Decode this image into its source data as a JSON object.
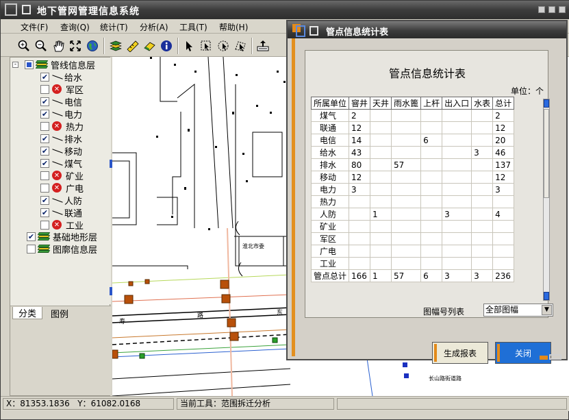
{
  "app": {
    "title": "地下管网管理信息系统"
  },
  "menu": [
    "文件(F)",
    "查询(Q)",
    "统计(T)",
    "分析(A)",
    "工具(T)",
    "帮助(H)"
  ],
  "toolbar": {
    "icons": [
      "zoom-in-icon",
      "zoom-out-icon",
      "pan-hand-icon",
      "full-extent-icon",
      "globe-icon",
      "layers-icon",
      "measure-icon",
      "eraser-icon",
      "info-icon",
      "pointer-icon",
      "select-rect-icon",
      "select-circle-icon",
      "select-poly-icon",
      "export-icon"
    ]
  },
  "tree": {
    "root": {
      "label": "管线信息层",
      "checked": "partial"
    },
    "items": [
      {
        "label": "给水",
        "checked": true
      },
      {
        "label": "军区",
        "checked": false
      },
      {
        "label": "电信",
        "checked": true
      },
      {
        "label": "电力",
        "checked": true
      },
      {
        "label": "热力",
        "checked": false
      },
      {
        "label": "排水",
        "checked": true
      },
      {
        "label": "移动",
        "checked": true
      },
      {
        "label": "煤气",
        "checked": true
      },
      {
        "label": "矿业",
        "checked": false
      },
      {
        "label": "广电",
        "checked": false
      },
      {
        "label": "人防",
        "checked": true
      },
      {
        "label": "联通",
        "checked": true
      },
      {
        "label": "工业",
        "checked": false
      }
    ],
    "layers": [
      {
        "label": "基础地形层",
        "checked": true
      },
      {
        "label": "图廓信息层",
        "checked": false
      }
    ]
  },
  "left_tabs": [
    "分类",
    "图例"
  ],
  "status": {
    "x_label": "X：",
    "x": "81353.1836",
    "y_label": "Y：",
    "y": "61082.0168",
    "tool": "当前工具：范围拆迁分析"
  },
  "map": {
    "labels": [
      "淮北市委",
      "寿",
      "路",
      "东",
      "长山路街道路"
    ]
  },
  "dialog": {
    "title": "管点信息统计表",
    "report_title": "管点信息统计表",
    "unit": "单位：个",
    "columns": [
      "所属单位",
      "窨井",
      "天井",
      "雨水篦",
      "上杆",
      "出入口",
      "水表",
      "总计"
    ],
    "rows": [
      [
        "煤气",
        "2",
        "",
        "",
        "",
        "",
        "",
        "2"
      ],
      [
        "联通",
        "12",
        "",
        "",
        "",
        "",
        "",
        "12"
      ],
      [
        "电信",
        "14",
        "",
        "",
        "6",
        "",
        "",
        "20"
      ],
      [
        "给水",
        "43",
        "",
        "",
        "",
        "",
        "3",
        "46"
      ],
      [
        "排水",
        "80",
        "",
        "57",
        "",
        "",
        "",
        "137"
      ],
      [
        "移动",
        "12",
        "",
        "",
        "",
        "",
        "",
        "12"
      ],
      [
        "电力",
        "3",
        "",
        "",
        "",
        "",
        "",
        "3"
      ],
      [
        "热力",
        "",
        "",
        "",
        "",
        "",
        "",
        ""
      ],
      [
        "人防",
        "",
        "1",
        "",
        "",
        "3",
        "",
        "4"
      ],
      [
        "矿业",
        "",
        "",
        "",
        "",
        "",
        "",
        ""
      ],
      [
        "军区",
        "",
        "",
        "",
        "",
        "",
        "",
        ""
      ],
      [
        "广电",
        "",
        "",
        "",
        "",
        "",
        "",
        ""
      ],
      [
        "工业",
        "",
        "",
        "",
        "",
        "",
        "",
        ""
      ],
      [
        "管点总计",
        "166",
        "1",
        "57",
        "6",
        "3",
        "3",
        "236"
      ]
    ],
    "map_list_label": "图幅号列表",
    "map_list_value": "全部图幅",
    "generate_label": "生成报表",
    "close_label": "关闭"
  },
  "colors": {
    "dialog_accent": "#e38a1a",
    "close_button": "#1f6fd6",
    "map_marker": "#b8500a"
  }
}
